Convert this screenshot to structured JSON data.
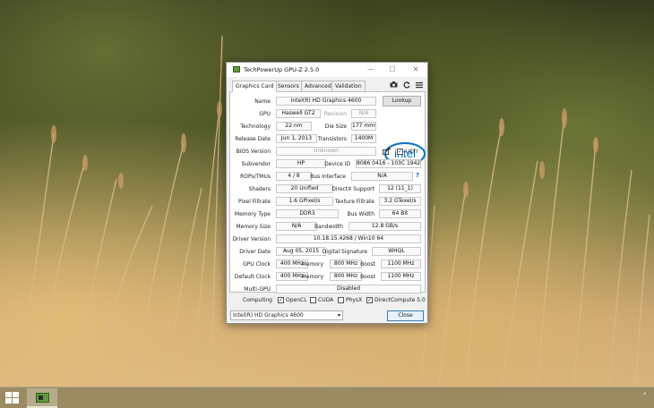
{
  "window": {
    "title": "TechPowerUp GPU-Z 2.5.0",
    "minimize_glyph": "—",
    "maximize_glyph": "☐",
    "close_glyph": "✕"
  },
  "tabs": [
    "Graphics Card",
    "Sensors",
    "Advanced",
    "Validation"
  ],
  "toolbar_icons": [
    "camera-icon",
    "refresh-icon",
    "menu-icon"
  ],
  "fields": {
    "name_label": "Name",
    "name": "Intel(R) HD Graphics 4600",
    "lookup": "Lookup",
    "gpu_label": "GPU",
    "gpu": "Haswell GT2",
    "revision_label": "Revision",
    "revision": "N/A",
    "technology_label": "Technology",
    "technology": "22 nm",
    "die_size_label": "Die Size",
    "die_size": "177 mm²",
    "release_date_label": "Release Date",
    "release_date": "Jun 1, 2013",
    "transistors_label": "Transistors",
    "transistors": "1400M",
    "bios_label": "BIOS Version",
    "bios": "Unknown",
    "uefi_label": "UEFI",
    "subvendor_label": "Subvendor",
    "subvendor": "HP",
    "device_id_label": "Device ID",
    "device_id": "8086 0416 - 103C 1942",
    "rops_label": "ROPs/TMUs",
    "rops": "4 / 8",
    "bus_label": "Bus Interface",
    "bus": "N/A",
    "shaders_label": "Shaders",
    "shaders": "20 Unified",
    "directx_label": "DirectX Support",
    "directx": "12 (11_1)",
    "pixel_label": "Pixel Fillrate",
    "pixel": "1.6 GPixel/s",
    "texture_label": "Texture Fillrate",
    "texture": "3.2 GTexel/s",
    "mem_type_label": "Memory Type",
    "mem_type": "DDR3",
    "bus_width_label": "Bus Width",
    "bus_width": "64 Bit",
    "mem_size_label": "Memory Size",
    "mem_size": "N/A",
    "bandwidth_label": "Bandwidth",
    "bandwidth": "12.8 GB/s",
    "driver_ver_label": "Driver Version",
    "driver_ver": "10.18.15.4268 / Win10 64",
    "driver_date_label": "Driver Date",
    "driver_date": "Aug 05, 2015",
    "signature_label": "Digital Signature",
    "signature": "WHQL",
    "gpu_clock_label": "GPU Clock",
    "gpu_clock": "400 MHz",
    "memory_label": "Memory",
    "mem_clock": "800 MHz",
    "boost_label": "Boost",
    "boost": "1100 MHz",
    "default_clock_label": "Default Clock",
    "default_clock": "400 MHz",
    "default_mem": "800 MHz",
    "default_boost": "1100 MHz",
    "multi_gpu_label": "Multi-GPU",
    "multi_gpu": "Disabled",
    "computing_label": "Computing",
    "opencl": "OpenCL",
    "cuda": "CUDA",
    "physx": "PhysX",
    "directcompute": "DirectCompute 5.0",
    "check_glyph": "✓",
    "help_glyph": "?",
    "logo_text": "intel"
  },
  "footer": {
    "selected_gpu": "Intel(R) HD Graphics 4600",
    "dropdown_glyph": "▾",
    "close": "Close"
  },
  "taskbar": {
    "tray_arrow": "˄"
  }
}
